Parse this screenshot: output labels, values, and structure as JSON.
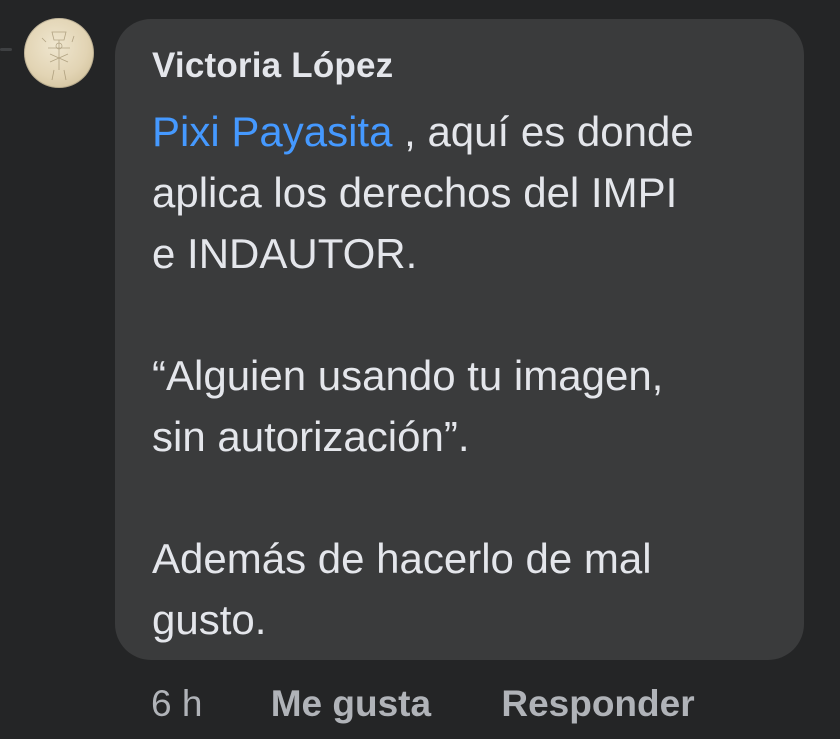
{
  "comment": {
    "author": "Victoria López",
    "mention": "Pixi Payasita",
    "line1_rest": " , aquí es donde",
    "line2": "aplica los derechos del IMPI",
    "line3": "e INDAUTOR.",
    "line4": "“Alguien usando tu imagen,",
    "line5": "sin autorización”.",
    "line6": "Además de hacerlo de mal",
    "line7": "gusto."
  },
  "actions": {
    "timestamp": "6 h",
    "like_label": "Me gusta",
    "reply_label": "Responder"
  },
  "colors": {
    "background": "#242526",
    "bubble": "#3a3b3c",
    "text": "#e4e6eb",
    "mention": "#4599ff",
    "secondary": "#b0b3b8"
  }
}
